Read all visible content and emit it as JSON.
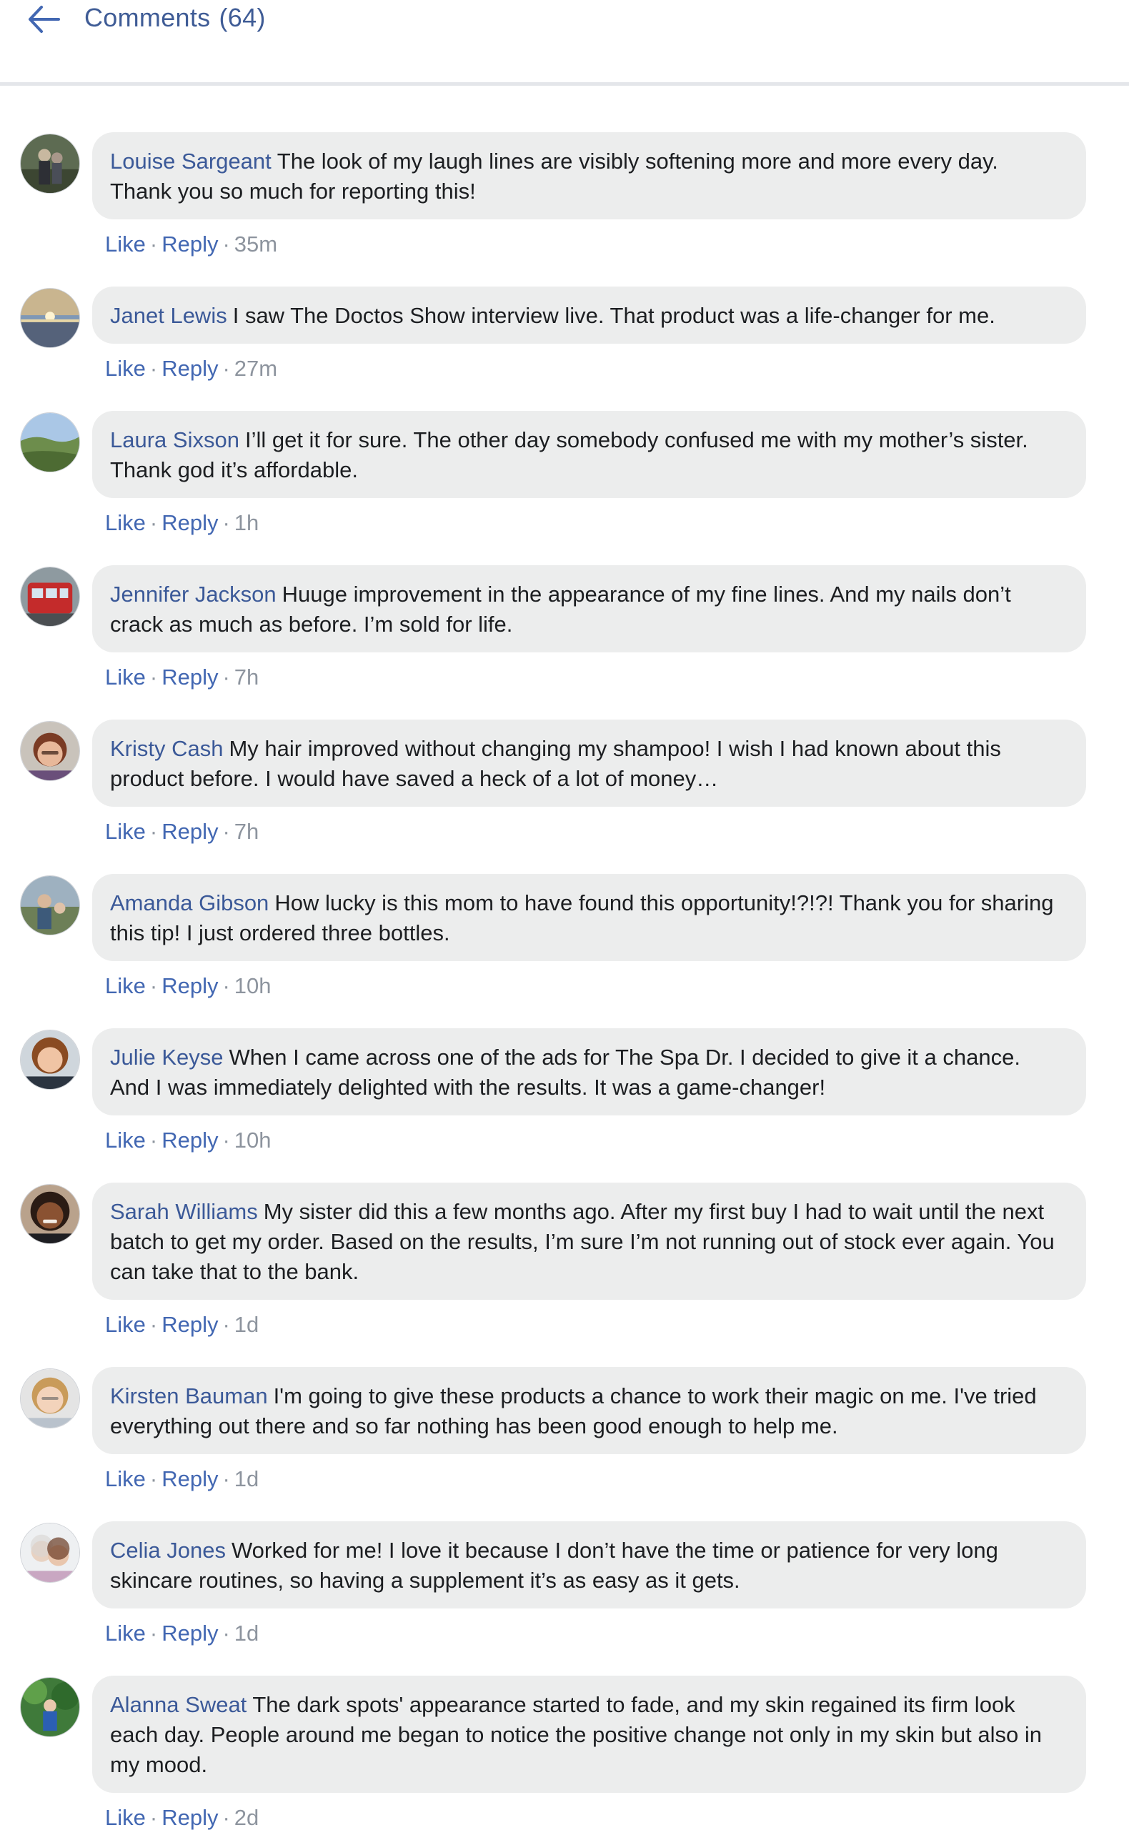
{
  "header": {
    "title": "Comments",
    "count": "(64)",
    "back_icon": "arrow-left-icon"
  },
  "actions": {
    "like_label": "Like",
    "reply_label": "Reply",
    "separator": "·"
  },
  "colors": {
    "author_blue": "#3b5998",
    "link_blue": "#4267b2",
    "bubble_bg": "#eceded",
    "meta_gray": "#8d949e"
  },
  "comments": [
    {
      "author": "Louise Sargeant",
      "text": "The look of my laugh lines are visibly softening more and more every day. Thank you so much for reporting this!",
      "time": "35m",
      "avatar_icon": "user-avatar-icon"
    },
    {
      "author": "Janet Lewis",
      "text": "I saw The Doctos Show interview live. That product was a life-changer for me.",
      "time": "27m",
      "avatar_icon": "user-avatar-icon"
    },
    {
      "author": "Laura Sixson",
      "text": "I’ll get it for sure. The other day somebody confused me with my mother’s sister. Thank god it’s affordable.",
      "time": "1h",
      "avatar_icon": "user-avatar-icon"
    },
    {
      "author": "Jennifer Jackson",
      "text": "Huuge improvement in the appearance of my fine lines. And my nails don’t crack as much as before. I’m sold for life.",
      "time": "7h",
      "avatar_icon": "user-avatar-icon"
    },
    {
      "author": "Kristy Cash",
      "text": "My hair improved without changing my shampoo! I wish I had known about this product before. I would have saved a heck of a lot of money…",
      "time": "7h",
      "avatar_icon": "user-avatar-icon"
    },
    {
      "author": "Amanda Gibson",
      "text": "How lucky is this mom to have found this opportunity!?!?! Thank you for sharing this tip! I just ordered three bottles.",
      "time": "10h",
      "avatar_icon": "user-avatar-icon"
    },
    {
      "author": "Julie Keyse",
      "text": "When I came across one of the ads for The Spa Dr. I decided to give it a chance. And I was immediately delighted with the results. It was a game-changer!",
      "time": "10h",
      "avatar_icon": "user-avatar-icon"
    },
    {
      "author": "Sarah Williams",
      "text": "My sister did this a few months ago. After my first buy I had to wait until the next batch to get my order. Based on the results, I’m sure I’m not running out of stock ever again. You can take that to the bank.",
      "time": "1d",
      "avatar_icon": "user-avatar-icon"
    },
    {
      "author": "Kirsten Bauman",
      "text": "I'm going to give these products a chance to work their magic on me. I've tried everything out there and so far nothing has been good enough to help me.",
      "time": "1d",
      "avatar_icon": "user-avatar-icon"
    },
    {
      "author": "Celia Jones",
      "text": "Worked for me! I love it because I don’t have the time or patience for very long skincare routines, so having a supplement it’s as easy as it gets.",
      "time": "1d",
      "avatar_icon": "user-avatar-icon"
    },
    {
      "author": "Alanna Sweat",
      "text": "The dark spots' appearance started to fade, and my skin regained its firm look each day. People around me began to notice the positive change not only in my skin but also in my mood.",
      "time": "2d",
      "avatar_icon": "user-avatar-icon"
    }
  ]
}
